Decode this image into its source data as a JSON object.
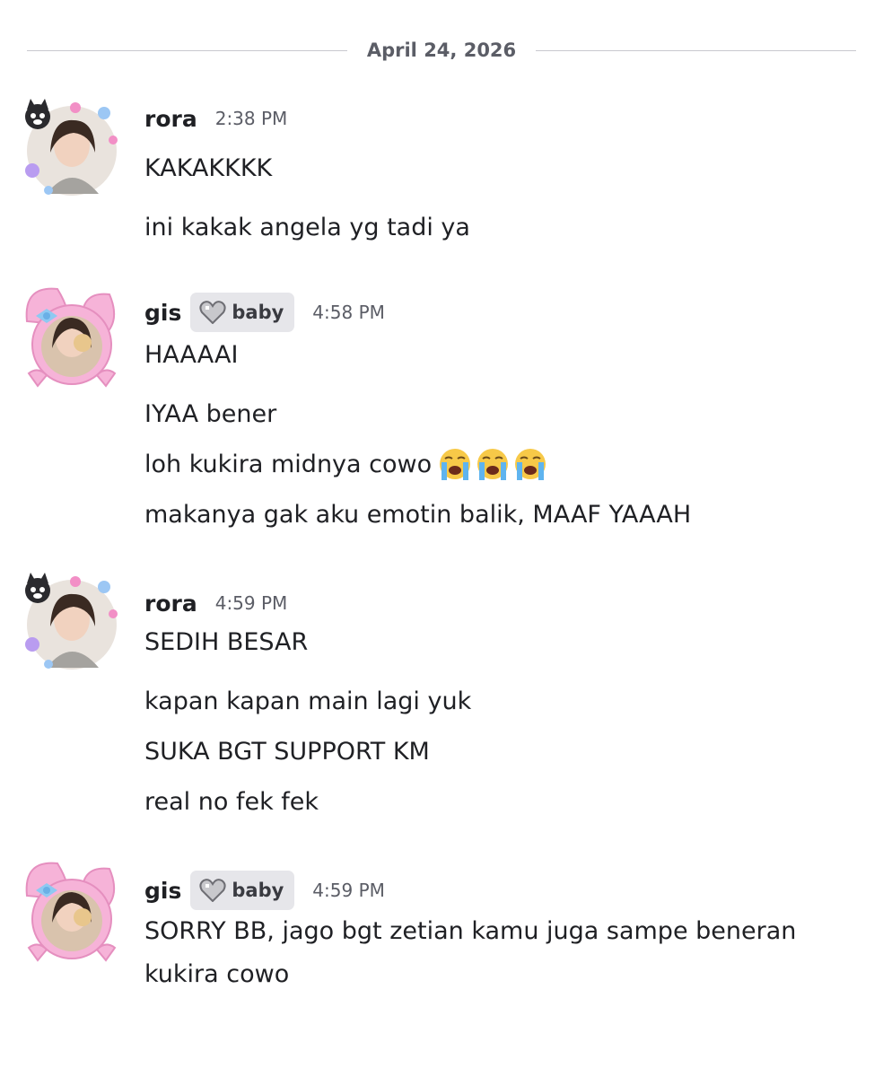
{
  "date_divider": "April 24, 2026",
  "messages": [
    {
      "author": "rora",
      "time": "2:38 PM",
      "lines": [
        "KAKAKKKK",
        "ini kakak angela yg tadi ya"
      ]
    },
    {
      "author": "gis",
      "tag": "baby",
      "time": "4:58 PM",
      "lines": [
        "HAAAAI",
        "IYAA bener",
        "loh kukira midnya cowo",
        "makanya gak aku emotin balik, MAAF YAAAH"
      ],
      "emoji": "loudly-crying-face x3"
    },
    {
      "author": "rora",
      "time": "4:59 PM",
      "lines": [
        "SEDIH BESAR",
        "kapan kapan main lagi yuk",
        "SUKA BGT SUPPORT KM",
        "real no fek fek"
      ]
    },
    {
      "author": "gis",
      "tag": "baby",
      "time": "4:59 PM",
      "lines": [
        "SORRY BB, jago bgt zetian kamu juga sampe beneran kukira cowo"
      ]
    }
  ],
  "icons": {
    "tag_icon": "grey-heart-icon",
    "avatar_rora": "cat-flower-avatar",
    "avatar_gis": "bunny-bow-avatar"
  },
  "colors": {
    "background": "#ffffff",
    "text": "#1f2024",
    "muted": "#5b5d66",
    "tag_bg": "#e6e6ea",
    "avatar_pink": "#f6b3d8"
  }
}
